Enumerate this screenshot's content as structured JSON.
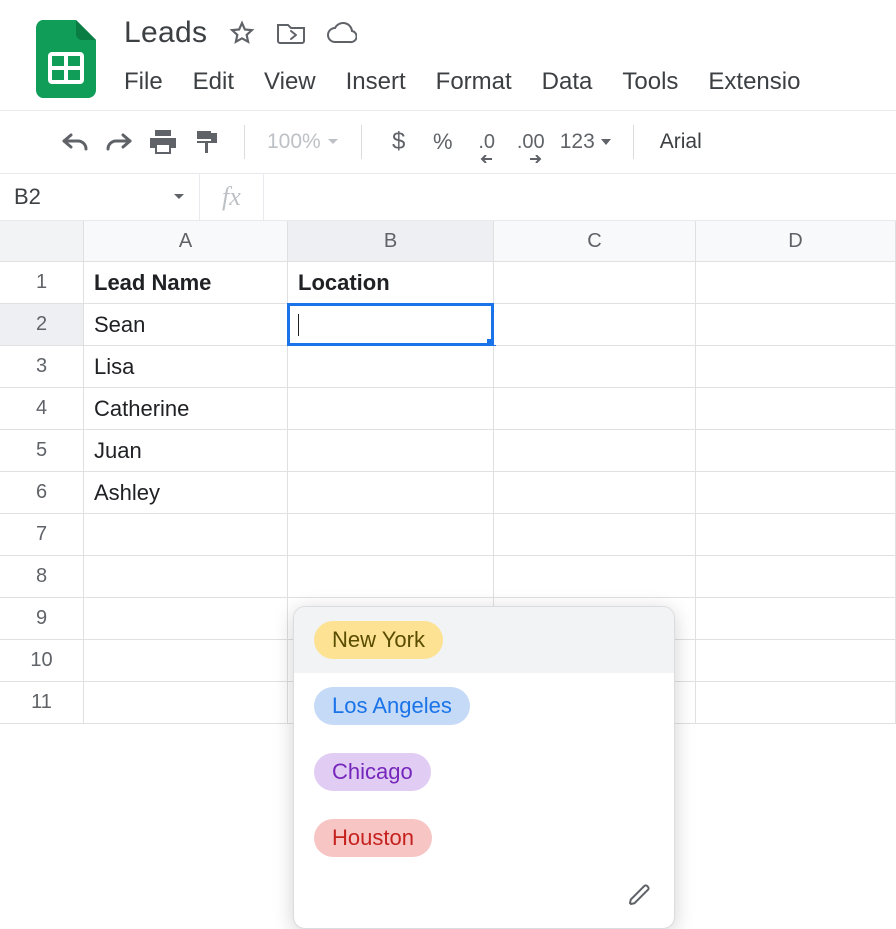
{
  "doc": {
    "title": "Leads"
  },
  "menu": {
    "file": "File",
    "edit": "Edit",
    "view": "View",
    "insert": "Insert",
    "format": "Format",
    "data": "Data",
    "tools": "Tools",
    "extensions": "Extensio"
  },
  "toolbar": {
    "zoom": "100%",
    "currency": "$",
    "percent": "%",
    "dec_dec": ".0",
    "dec_inc": ".00",
    "numfmt": "123",
    "font": "Arial"
  },
  "namebox": {
    "ref": "B2"
  },
  "fx": {
    "label": "fx"
  },
  "columns": {
    "A": "A",
    "B": "B",
    "C": "C",
    "D": "D"
  },
  "rows": [
    "1",
    "2",
    "3",
    "4",
    "5",
    "6",
    "7",
    "8",
    "9",
    "10",
    "11"
  ],
  "data": {
    "A1": "Lead Name",
    "B1": "Location",
    "A2": "Sean",
    "A3": "Lisa",
    "A4": "Catherine",
    "A5": "Juan",
    "A6": "Ashley"
  },
  "dropdown": {
    "options": [
      {
        "label": "New York",
        "color_key": "ny"
      },
      {
        "label": "Los Angeles",
        "color_key": "la"
      },
      {
        "label": "Chicago",
        "color_key": "chi"
      },
      {
        "label": "Houston",
        "color_key": "hou"
      }
    ]
  }
}
